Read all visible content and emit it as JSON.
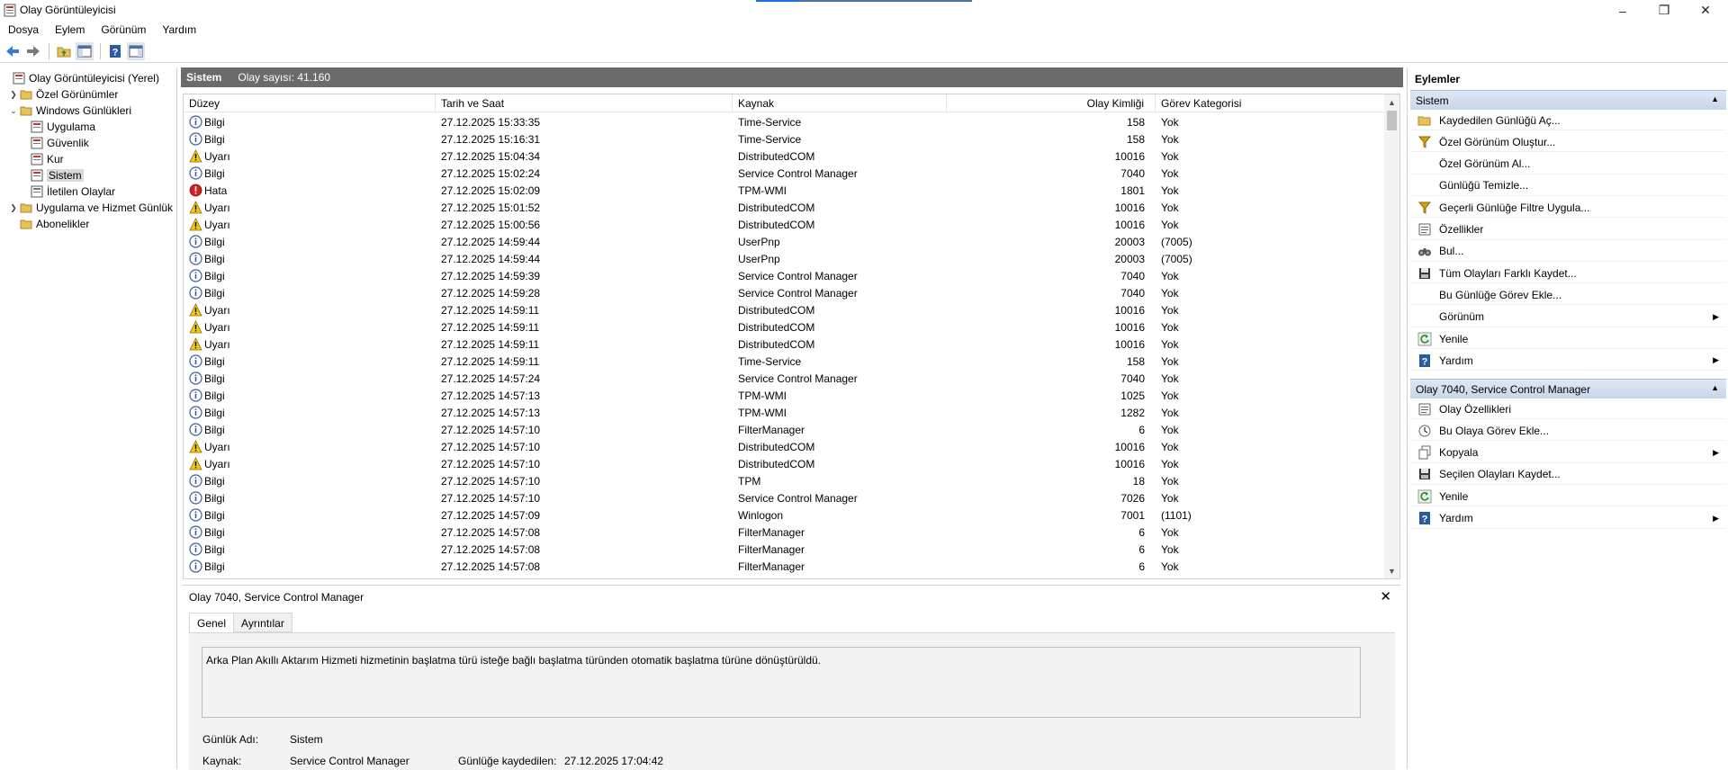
{
  "window": {
    "title": "Olay Görüntüleyicisi",
    "minimize": "–",
    "maximize": "❐",
    "close": "✕"
  },
  "menu": [
    "Dosya",
    "Eylem",
    "Görünüm",
    "Yardım"
  ],
  "tree": {
    "root": "Olay Görüntüleyicisi (Yerel)",
    "custom_views": "Özel Görünümler",
    "windows_logs": "Windows Günlükleri",
    "logs": [
      "Uygulama",
      "Güvenlik",
      "Kur",
      "Sistem",
      "İletilen Olaylar"
    ],
    "app_service_logs": "Uygulama ve Hizmet Günlük",
    "subscriptions": "Abonelikler"
  },
  "center": {
    "log_name": "Sistem",
    "event_count": "Olay sayısı: 41.160",
    "columns": [
      "Düzey",
      "Tarih ve Saat",
      "Kaynak",
      "Olay Kimliği",
      "Görev Kategorisi"
    ],
    "rows": [
      {
        "level": "Bilgi",
        "type": "info",
        "datetime": "27.12.2025 15:33:35",
        "source": "Time-Service",
        "id": "158",
        "category": "Yok"
      },
      {
        "level": "Bilgi",
        "type": "info",
        "datetime": "27.12.2025 15:16:31",
        "source": "Time-Service",
        "id": "158",
        "category": "Yok"
      },
      {
        "level": "Uyarı",
        "type": "warn",
        "datetime": "27.12.2025 15:04:34",
        "source": "DistributedCOM",
        "id": "10016",
        "category": "Yok"
      },
      {
        "level": "Bilgi",
        "type": "info",
        "datetime": "27.12.2025 15:02:24",
        "source": "Service Control Manager",
        "id": "7040",
        "category": "Yok"
      },
      {
        "level": "Hata",
        "type": "error",
        "datetime": "27.12.2025 15:02:09",
        "source": "TPM-WMI",
        "id": "1801",
        "category": "Yok"
      },
      {
        "level": "Uyarı",
        "type": "warn",
        "datetime": "27.12.2025 15:01:52",
        "source": "DistributedCOM",
        "id": "10016",
        "category": "Yok"
      },
      {
        "level": "Uyarı",
        "type": "warn",
        "datetime": "27.12.2025 15:00:56",
        "source": "DistributedCOM",
        "id": "10016",
        "category": "Yok"
      },
      {
        "level": "Bilgi",
        "type": "info",
        "datetime": "27.12.2025 14:59:44",
        "source": "UserPnp",
        "id": "20003",
        "category": "(7005)"
      },
      {
        "level": "Bilgi",
        "type": "info",
        "datetime": "27.12.2025 14:59:44",
        "source": "UserPnp",
        "id": "20003",
        "category": "(7005)"
      },
      {
        "level": "Bilgi",
        "type": "info",
        "datetime": "27.12.2025 14:59:39",
        "source": "Service Control Manager",
        "id": "7040",
        "category": "Yok"
      },
      {
        "level": "Bilgi",
        "type": "info",
        "datetime": "27.12.2025 14:59:28",
        "source": "Service Control Manager",
        "id": "7040",
        "category": "Yok"
      },
      {
        "level": "Uyarı",
        "type": "warn",
        "datetime": "27.12.2025 14:59:11",
        "source": "DistributedCOM",
        "id": "10016",
        "category": "Yok"
      },
      {
        "level": "Uyarı",
        "type": "warn",
        "datetime": "27.12.2025 14:59:11",
        "source": "DistributedCOM",
        "id": "10016",
        "category": "Yok"
      },
      {
        "level": "Uyarı",
        "type": "warn",
        "datetime": "27.12.2025 14:59:11",
        "source": "DistributedCOM",
        "id": "10016",
        "category": "Yok"
      },
      {
        "level": "Bilgi",
        "type": "info",
        "datetime": "27.12.2025 14:59:11",
        "source": "Time-Service",
        "id": "158",
        "category": "Yok"
      },
      {
        "level": "Bilgi",
        "type": "info",
        "datetime": "27.12.2025 14:57:24",
        "source": "Service Control Manager",
        "id": "7040",
        "category": "Yok"
      },
      {
        "level": "Bilgi",
        "type": "info",
        "datetime": "27.12.2025 14:57:13",
        "source": "TPM-WMI",
        "id": "1025",
        "category": "Yok"
      },
      {
        "level": "Bilgi",
        "type": "info",
        "datetime": "27.12.2025 14:57:13",
        "source": "TPM-WMI",
        "id": "1282",
        "category": "Yok"
      },
      {
        "level": "Bilgi",
        "type": "info",
        "datetime": "27.12.2025 14:57:10",
        "source": "FilterManager",
        "id": "6",
        "category": "Yok"
      },
      {
        "level": "Uyarı",
        "type": "warn",
        "datetime": "27.12.2025 14:57:10",
        "source": "DistributedCOM",
        "id": "10016",
        "category": "Yok"
      },
      {
        "level": "Uyarı",
        "type": "warn",
        "datetime": "27.12.2025 14:57:10",
        "source": "DistributedCOM",
        "id": "10016",
        "category": "Yok"
      },
      {
        "level": "Bilgi",
        "type": "info",
        "datetime": "27.12.2025 14:57:10",
        "source": "TPM",
        "id": "18",
        "category": "Yok"
      },
      {
        "level": "Bilgi",
        "type": "info",
        "datetime": "27.12.2025 14:57:10",
        "source": "Service Control Manager",
        "id": "7026",
        "category": "Yok"
      },
      {
        "level": "Bilgi",
        "type": "info",
        "datetime": "27.12.2025 14:57:09",
        "source": "Winlogon",
        "id": "7001",
        "category": "(1101)"
      },
      {
        "level": "Bilgi",
        "type": "info",
        "datetime": "27.12.2025 14:57:08",
        "source": "FilterManager",
        "id": "6",
        "category": "Yok"
      },
      {
        "level": "Bilgi",
        "type": "info",
        "datetime": "27.12.2025 14:57:08",
        "source": "FilterManager",
        "id": "6",
        "category": "Yok"
      },
      {
        "level": "Bilgi",
        "type": "info",
        "datetime": "27.12.2025 14:57:08",
        "source": "FilterManager",
        "id": "6",
        "category": "Yok"
      }
    ]
  },
  "detail": {
    "title": "Olay 7040, Service Control Manager",
    "close": "✕",
    "tabs": [
      "Genel",
      "Ayrıntılar"
    ],
    "description": "Arka Plan Akıllı Aktarım Hizmeti hizmetinin başlatma türü isteğe bağlı başlatma türünden otomatik başlatma türüne dönüştürüldü.",
    "log_name_label": "Günlük Adı:",
    "log_name_value": "Sistem",
    "source_label": "Kaynak:",
    "source_value": "Service Control Manager",
    "logged_label": "Günlüğe kaydedilen:",
    "logged_value": "27.12.2025 17:04:42"
  },
  "actions": {
    "title": "Eylemler",
    "section1": "Sistem",
    "section1_items": [
      {
        "label": "Kaydedilen Günlüğü Aç...",
        "icon": "folder-open-icon"
      },
      {
        "label": "Özel Görünüm Oluştur...",
        "icon": "filter-icon"
      },
      {
        "label": "Özel Görünüm Al...",
        "icon": "none"
      },
      {
        "label": "Günlüğü Temizle...",
        "icon": "none"
      },
      {
        "label": "Geçerli Günlüğe Filtre Uygula...",
        "icon": "filter-icon"
      },
      {
        "label": "Özellikler",
        "icon": "properties-icon"
      },
      {
        "label": "Bul...",
        "icon": "binoculars-icon"
      },
      {
        "label": "Tüm Olayları Farklı Kaydet...",
        "icon": "save-icon"
      },
      {
        "label": "Bu Günlüğe Görev Ekle...",
        "icon": "none"
      },
      {
        "label": "Görünüm",
        "icon": "none",
        "submenu": true
      },
      {
        "label": "Yenile",
        "icon": "refresh-icon"
      },
      {
        "label": "Yardım",
        "icon": "help-icon",
        "submenu": true
      }
    ],
    "section2": "Olay 7040, Service Control Manager",
    "section2_items": [
      {
        "label": "Olay Özellikleri",
        "icon": "properties-icon"
      },
      {
        "label": "Bu Olaya Görev Ekle...",
        "icon": "task-icon"
      },
      {
        "label": "Kopyala",
        "icon": "copy-icon",
        "submenu": true
      },
      {
        "label": "Seçilen Olayları Kaydet...",
        "icon": "save-icon"
      },
      {
        "label": "Yenile",
        "icon": "refresh-icon"
      },
      {
        "label": "Yardım",
        "icon": "help-icon",
        "submenu": true
      }
    ]
  }
}
